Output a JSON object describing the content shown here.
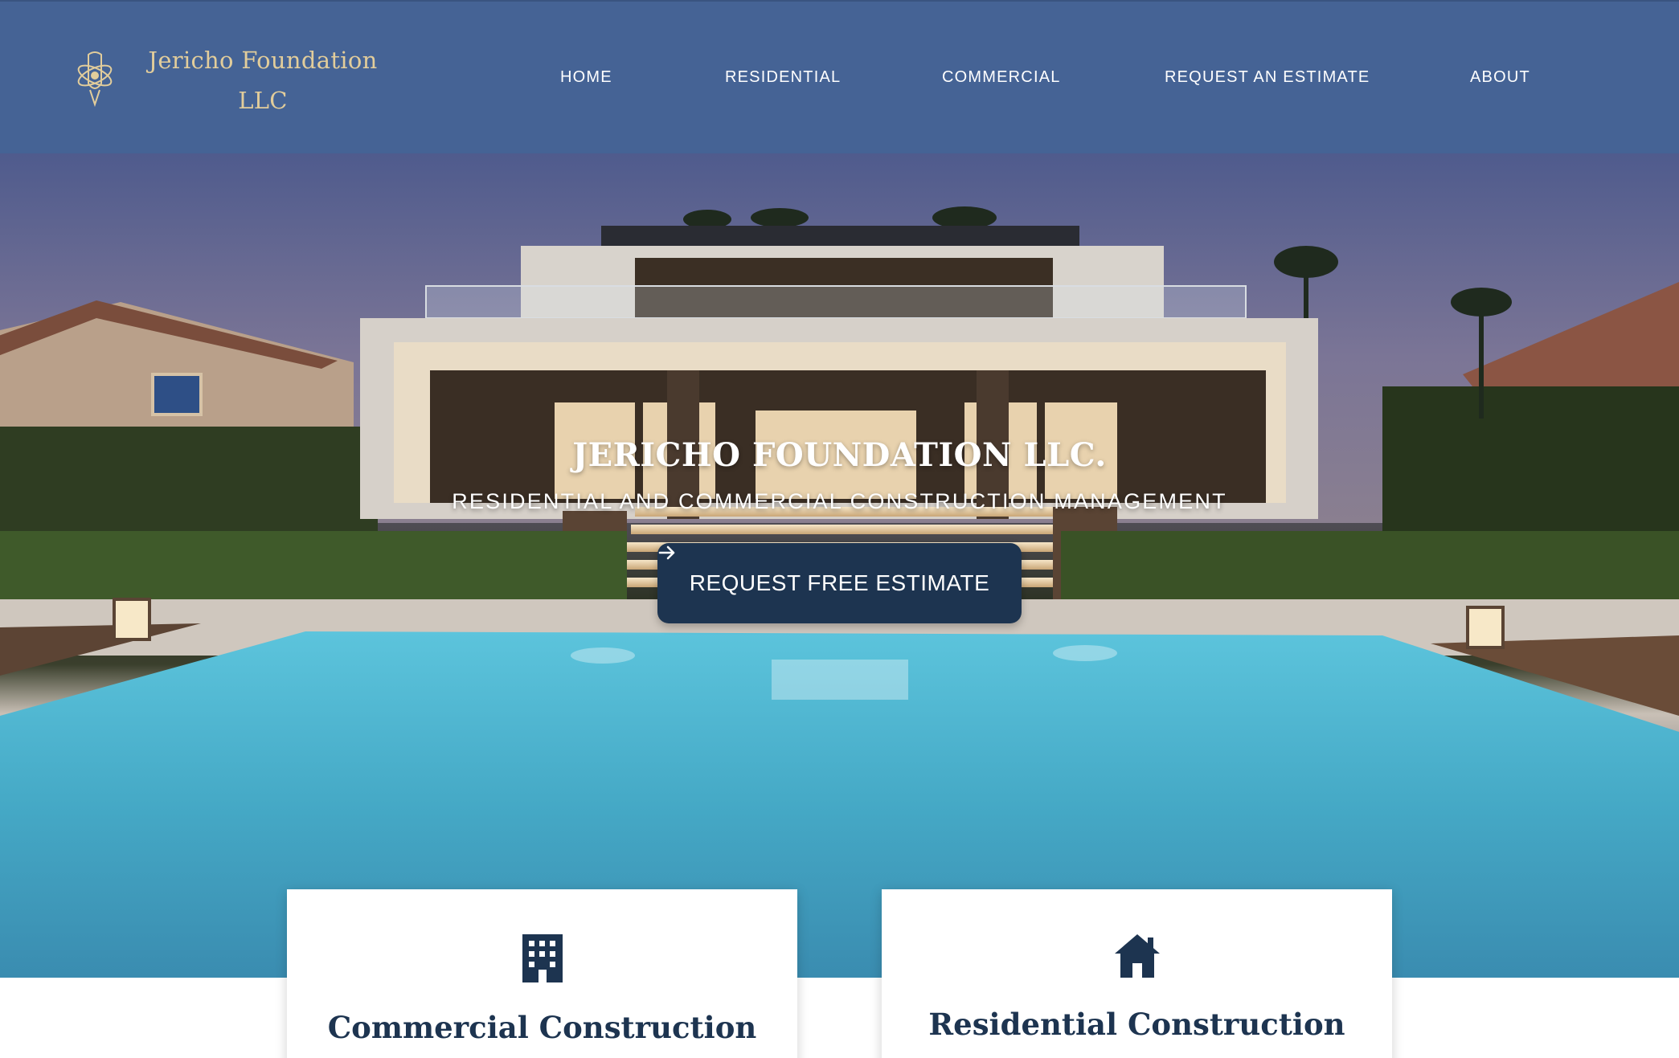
{
  "brand": {
    "name_line1": "Jericho Foundation",
    "name_line2": "LLC",
    "logo_icon": "atom-crest-icon"
  },
  "nav": {
    "items": [
      {
        "label": "HOME"
      },
      {
        "label": "RESIDENTIAL"
      },
      {
        "label": "COMMERCIAL"
      },
      {
        "label": "REQUEST AN ESTIMATE"
      },
      {
        "label": "ABOUT"
      }
    ]
  },
  "hero": {
    "title": "JERICHO FOUNDATION LLC.",
    "subtitle": "RESIDENTIAL AND COMMERCIAL CONSTRUCTION MANAGEMENT",
    "cta_label": "REQUEST FREE ESTIMATE",
    "cta_icon": "arrow-right-icon"
  },
  "services": [
    {
      "title": "Commercial Construction",
      "icon": "building-icon"
    },
    {
      "title": "Residential Construction",
      "icon": "house-icon"
    }
  ],
  "colors": {
    "header_bg": "#456395",
    "logo_gold": "#e2cd9b",
    "cta_bg": "#1d3450",
    "card_title": "#1d3450",
    "pool": "#4aaec8"
  }
}
